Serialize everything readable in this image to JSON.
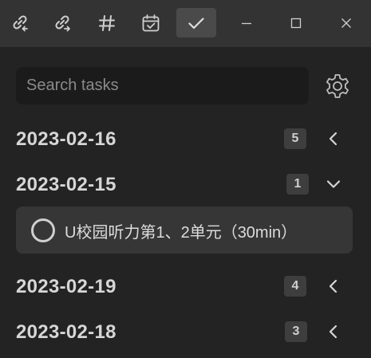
{
  "toolbar": {
    "buttons": [
      {
        "icon": "link-incoming-icon"
      },
      {
        "icon": "link-outgoing-icon"
      },
      {
        "icon": "hashtag-icon"
      },
      {
        "icon": "calendar-check-icon"
      },
      {
        "icon": "checkmark-icon",
        "active": true
      }
    ],
    "window_controls": [
      "minimize-icon",
      "maximize-icon",
      "close-icon"
    ]
  },
  "search": {
    "placeholder": "Search tasks",
    "value": ""
  },
  "groups": [
    {
      "date": "2023-02-16",
      "count": "5",
      "expanded": false
    },
    {
      "date": "2023-02-15",
      "count": "1",
      "expanded": true,
      "tasks": [
        {
          "label": "U校园听力第1、2单元（30min）",
          "done": false
        }
      ]
    },
    {
      "date": "2023-02-19",
      "count": "4",
      "expanded": false
    },
    {
      "date": "2023-02-18",
      "count": "3",
      "expanded": false
    }
  ],
  "colors": {
    "background": "#232323",
    "titlebar": "#333333",
    "active_button": "#4a4a4a",
    "text": "#d4d4d4"
  }
}
